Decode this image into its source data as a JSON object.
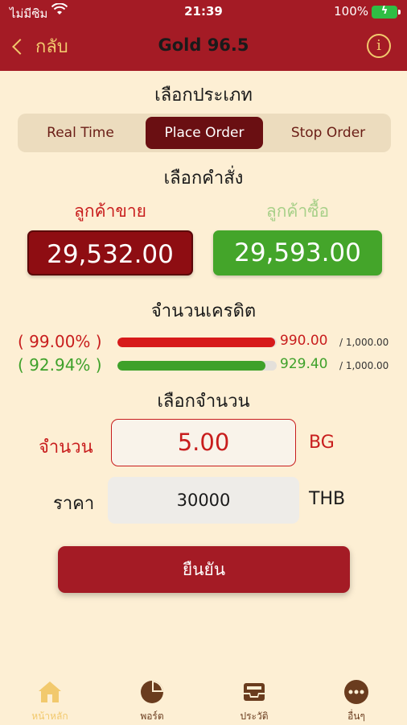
{
  "status": {
    "carrier": "ไม่มีซิม",
    "time": "21:39",
    "battery": "100%"
  },
  "header": {
    "back_label": "กลับ",
    "title": "Gold 96.5",
    "info_icon": "info-icon"
  },
  "type_section": {
    "title": "เลือกประเภท",
    "options": [
      "Real Time",
      "Place Order",
      "Stop Order"
    ],
    "selected": "Place Order"
  },
  "order_section": {
    "title": "เลือกคำสั่ง",
    "sell_label": "ลูกค้าขาย",
    "buy_label": "ลูกค้าซื้อ",
    "sell_price": "29,532.00",
    "buy_price": "29,593.00"
  },
  "credit_section": {
    "title": "จำนวนเครดิต",
    "rows": [
      {
        "percent": "( 99.00% )",
        "fraction": 0.99,
        "value": "990.00",
        "max": "/ 1,000.00",
        "color": "#d71a1a"
      },
      {
        "percent": "( 92.94% )",
        "fraction": 0.9294,
        "value": "929.40",
        "max": "/ 1,000.00",
        "color": "#3ea12a"
      }
    ]
  },
  "amount_section": {
    "title": "เลือกจำนวน",
    "amount_label": "จำนวน",
    "amount_value": "5.00",
    "amount_unit": "BG",
    "price_label": "ราคา",
    "price_value": "30000",
    "price_unit": "THB"
  },
  "confirm_label": "ยืนยัน",
  "tabs": [
    {
      "label": "หน้าหลัก",
      "icon": "home-icon",
      "active": true
    },
    {
      "label": "พอร์ต",
      "icon": "pie-chart-icon",
      "active": false
    },
    {
      "label": "ประวัติ",
      "icon": "inbox-icon",
      "active": false
    },
    {
      "label": "อื่นๆ",
      "icon": "more-icon",
      "active": false
    }
  ],
  "colors": {
    "brand_red": "#a41b25",
    "dark_red": "#6a0f12",
    "gold": "#f2c96d",
    "buy_green": "#44a52a",
    "background": "#fdefd4"
  }
}
